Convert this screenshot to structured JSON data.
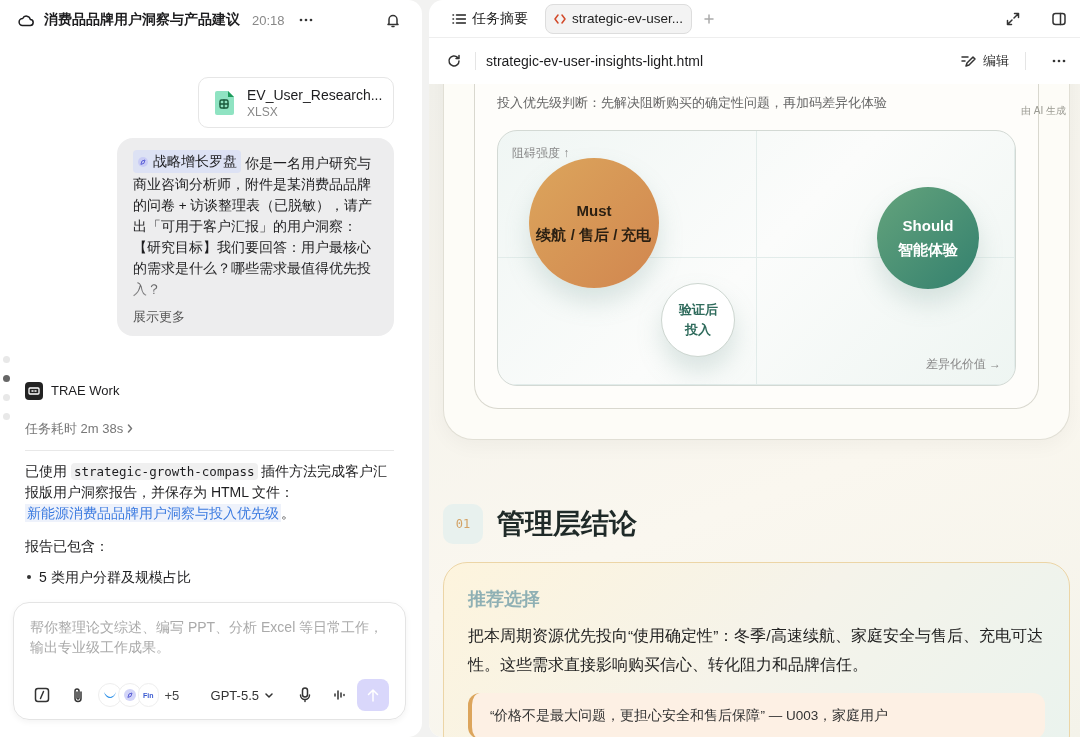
{
  "chat": {
    "title": "消费品品牌用户洞察与产品建议",
    "time": "20:18",
    "attachment": {
      "name": "EV_User_Research...",
      "type": "XLSX"
    },
    "message": {
      "tag": "战略增长罗盘",
      "paragraphs": [
        "你是一名用户研究与商业咨询分析师，附件是某消费品品牌的问卷 + 访谈整理表（已脱敏），请产出「可用于客户汇报」的用户洞察：",
        "【研究目标】我们要回答：用户最核心的需求是什么？哪些需求最值得优先投入？"
      ],
      "show_more": "展示更多"
    },
    "steps": [
      {
        "selected": false
      },
      {
        "selected": true
      },
      {
        "selected": false
      },
      {
        "selected": false
      }
    ],
    "agent": {
      "name": "TRAE Work",
      "duration": "任务耗时 2m 38s"
    },
    "reply": {
      "before": "已使用 ",
      "code": "strategic-growth-compass",
      "after": " 插件方法完成客户汇报版用户洞察报告，并保存为 HTML 文件：",
      "link": "新能源消费品品牌用户洞察与投入优先级",
      "end": "。",
      "contains": "报告已包含：",
      "bullets": [
        "5 类用户分群及规模占比"
      ]
    },
    "composer": {
      "placeholder": "帮你整理论文综述、编写 PPT、分析 Excel 等日常工作，输出专业级工作成果。",
      "plugin_badge": "Fin",
      "more_plugins": "+5",
      "model": "GPT-5.5"
    }
  },
  "preview": {
    "tabs": [
      {
        "label": "任务摘要",
        "kind": "summary",
        "selected": false
      },
      {
        "label": "strategic-ev-user...",
        "kind": "file",
        "selected": true
      }
    ],
    "file_name": "strategic-ev-user-insights-light.html",
    "edit": "编辑",
    "page": {
      "priority_note": "投入优先级判断：先解决阻断购买的确定性问题，再加码差异化体验",
      "ai_label": "由 AI 生成",
      "matrix": {
        "y_axis": "阻碍强度 ↑",
        "x_axis": "差异化价值 →",
        "bubbles": [
          {
            "kind": "must",
            "lines": [
              "Must",
              "续航 / 售后 / 充电"
            ]
          },
          {
            "kind": "should",
            "lines": [
              "Should",
              "智能体验"
            ]
          },
          {
            "kind": "validate",
            "lines": [
              "验证后",
              "投入"
            ]
          }
        ]
      },
      "section": {
        "number": "01",
        "title": "管理层结论"
      },
      "card": {
        "label": "推荐选择",
        "text": "把本周期资源优先投向“使用确定性”：冬季/高速续航、家庭安全与售后、充电可达性。这些需求直接影响购买信心、转化阻力和品牌信任。",
        "quote": "“价格不是最大问题，更担心安全和售后保障” — U003，家庭用户"
      }
    }
  }
}
